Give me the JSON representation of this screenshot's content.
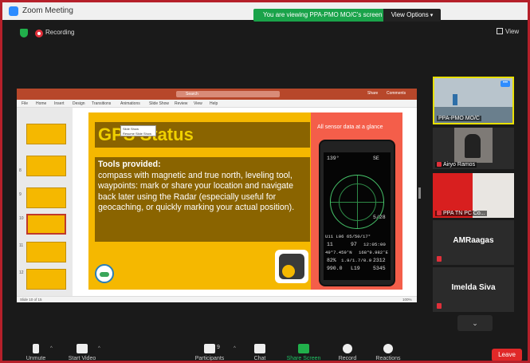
{
  "window": {
    "title": "Zoom Meeting",
    "viewing_banner": "You are viewing PPA-PMO MO/C's screen",
    "view_options_label": "View Options",
    "view_label": "View"
  },
  "top_status": {
    "recording_label": "Recording"
  },
  "powerpoint": {
    "menu_items": [
      "File",
      "Home",
      "Insert",
      "Design",
      "Transitions",
      "Animations",
      "Slide Show",
      "Review",
      "View",
      "Help"
    ],
    "search_placeholder": "Search",
    "share_label": "Share",
    "comments_label": "Comments",
    "slide_numbers": [
      "8",
      "9",
      "10",
      "11",
      "12"
    ],
    "status_left": "Slide 10 of 15",
    "zoom_level": "100%"
  },
  "slide": {
    "title": "GPS Status",
    "dropdown_options": [
      "Slide Show",
      "Resume Slide Show"
    ],
    "tools_heading": "Tools provided:",
    "tools_body": "compass with magnetic and true north, leveling tool, waypoints: mark or share your location and navigate back later using the Radar (especially useful for geocaching, or quickly marking your actual position).",
    "sensor_caption": "All sensor data at a glance",
    "phone_readings": {
      "r1": "139°",
      "r2": "SE",
      "r3": "5/28",
      "r4": "U11 L06 65/50/17°",
      "r5": "11",
      "r6": "97",
      "r7": "12:05:00",
      "r8": "49°7.459'N",
      "r9": "168°9.982'E",
      "r10": "82%",
      "r11": "1.9/1.7/0.9",
      "r12": "2312",
      "r13": "990.0",
      "r14": "L19",
      "r15": "5345"
    }
  },
  "participants": [
    {
      "name": "PPA-PMO MO/C",
      "type": "video",
      "active": true
    },
    {
      "name": "Airyo Ramos",
      "type": "video",
      "muted": true
    },
    {
      "name": "PPA TN PC Co...",
      "type": "video",
      "muted": true
    },
    {
      "name": "AMRaagas",
      "type": "name-only",
      "muted": true
    },
    {
      "name": "Imelda Siva",
      "type": "name-only",
      "muted": true
    }
  ],
  "toolbar": {
    "unmute": "Unmute",
    "start_video": "Start Video",
    "participants": "Participants",
    "participants_count": "9",
    "chat": "Chat",
    "share_screen": "Share Screen",
    "record": "Record",
    "reactions": "Reactions",
    "leave": "Leave"
  },
  "colors": {
    "frame_border": "#b5202a",
    "viewing_banner": "#1aa34a",
    "slide_bg": "#f5b800",
    "slide_box": "#8a6400",
    "slide_right": "#f45e4a",
    "leave_button": "#e02828",
    "active_speaker": "#e8e000"
  }
}
